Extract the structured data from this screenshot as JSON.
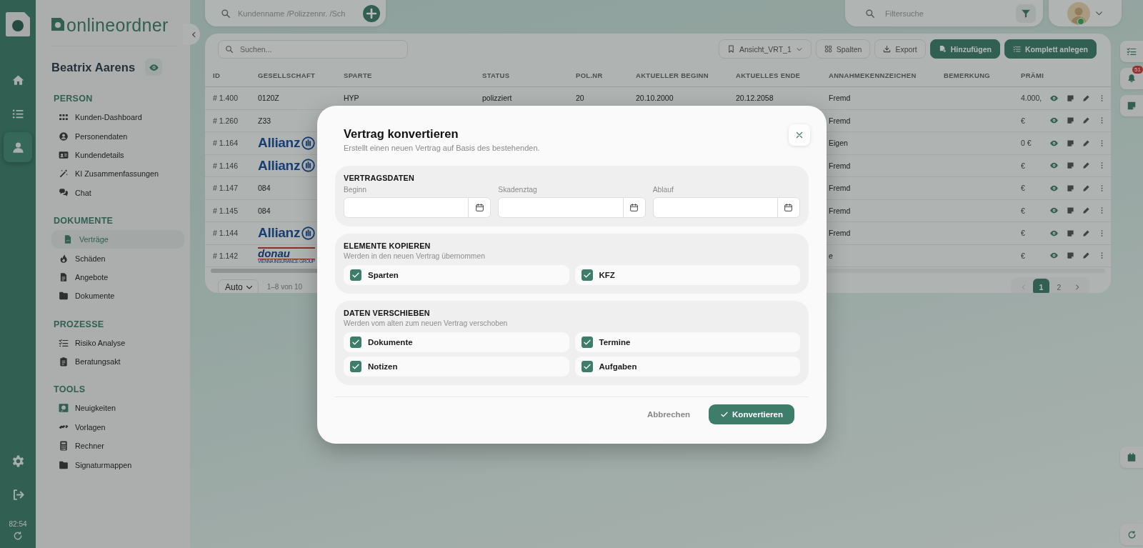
{
  "rail": {
    "items": [
      {
        "selected": false
      },
      {
        "selected": false
      },
      {
        "selected": true
      }
    ],
    "time": "82:54"
  },
  "sidebar": {
    "brand": "onlineordner",
    "customer_name": "Beatrix Aarens",
    "sections": [
      {
        "title": "PERSON",
        "items": [
          {
            "label": "Kunden-Dashboard",
            "selected": false
          },
          {
            "label": "Personendaten",
            "selected": false
          },
          {
            "label": "Kundendetails",
            "selected": false
          },
          {
            "label": "KI Zusammenfassungen",
            "selected": false
          },
          {
            "label": "Chat",
            "selected": false
          }
        ]
      },
      {
        "title": "DOKUMENTE",
        "items": [
          {
            "label": "Verträge",
            "selected": true
          },
          {
            "label": "Schäden",
            "selected": false
          },
          {
            "label": "Angebote",
            "selected": false
          },
          {
            "label": "Dokumente",
            "selected": false
          }
        ]
      },
      {
        "title": "PROZESSE",
        "items": [
          {
            "label": "Risiko Analyse",
            "selected": false
          },
          {
            "label": "Beratungsakt",
            "selected": false
          }
        ]
      },
      {
        "title": "TOOLS",
        "items": [
          {
            "label": "Neuigkeiten",
            "selected": false
          },
          {
            "label": "Vorlagen",
            "selected": false
          },
          {
            "label": "Rechner",
            "selected": false
          },
          {
            "label": "Signaturmappen",
            "selected": false
          }
        ]
      }
    ]
  },
  "top_bar": {
    "search": {
      "placeholder": "Kundenname /Polizzennr. /Sch"
    },
    "filter": {
      "placeholder": "Filtersuche"
    }
  },
  "table_toolbar": {
    "search": {
      "placeholder": "Suchen..."
    },
    "view": "Ansicht_VRT_1",
    "buttons": [
      {
        "label": "Spalten",
        "primary": false
      },
      {
        "label": "Export",
        "primary": false
      },
      {
        "label": "Hinzufügen",
        "primary": true
      },
      {
        "label": "Komplett anlegen",
        "primary": true
      }
    ]
  },
  "table": {
    "columns": [
      "ID",
      "GESELLSCHAFT",
      "SPARTE",
      "STATUS",
      "POL.NR",
      "AKTUELLER BEGINN",
      "AKTUELLES ENDE",
      "ANNAHMEKENNZEICHEN",
      "BEMERKUNG",
      "PRÄMI"
    ],
    "rows": [
      {
        "id": "# 1.400",
        "company": {
          "kind": "text",
          "text": "0120Z"
        },
        "sparte": "HYP",
        "status": "polizziert",
        "pol_nr": "20",
        "begin": "20.10.2000",
        "end": "20.12.2058",
        "annahme": "Fremd",
        "praemie": "4.000,"
      },
      {
        "id": "# 1.260",
        "company": {
          "kind": "text",
          "text": "Z33"
        },
        "annahme": "Fremd",
        "praemie": "€"
      },
      {
        "id": "# 1.164",
        "company": {
          "kind": "wordmark",
          "text": "Allianz"
        },
        "annahme": "Eigen",
        "praemie": "0 €"
      },
      {
        "id": "# 1.146",
        "company": {
          "kind": "wordmark",
          "text": "Allianz"
        },
        "annahme": "Fremd",
        "praemie": "€"
      },
      {
        "id": "# 1.147",
        "company": {
          "kind": "text",
          "text": "084"
        },
        "annahme": "Fremd",
        "praemie": "€"
      },
      {
        "id": "# 1.145",
        "company": {
          "kind": "text",
          "text": "084"
        },
        "annahme": "Fremd",
        "praemie": "€"
      },
      {
        "id": "# 1.144",
        "company": {
          "kind": "wordmark",
          "text": "Allianz"
        },
        "annahme": "Fremd",
        "praemie": "€"
      },
      {
        "id": "# 1.142",
        "company": {
          "kind": "striped",
          "text": "donau",
          "subtitle": "VIENNA INSURANCE GROUP"
        },
        "annahme": "e",
        "praemie": "€"
      }
    ]
  },
  "footer": {
    "page_size": "Auto",
    "range": "1–8 von 10",
    "prev_disabled": true,
    "pages": [
      {
        "label": "1",
        "selected": true
      },
      {
        "label": "2",
        "selected": false
      }
    ]
  },
  "right_strip": {
    "badge": "51"
  },
  "modal": {
    "title": "Vertrag konvertieren",
    "subtitle": "Erstellt einen neuen Vertrag auf Basis des bestehenden.",
    "sections": [
      {
        "kind": "dates",
        "title": "VERTRAGSDATEN",
        "fields": [
          {
            "label": "Beginn"
          },
          {
            "label": "Skadenztag"
          },
          {
            "label": "Ablauf"
          }
        ]
      },
      {
        "kind": "checks",
        "title": "ELEMENTE KOPIEREN",
        "hint": "Werden in den neuen Vertrag übernommen",
        "options": [
          {
            "label": "Sparten",
            "checked": true
          },
          {
            "label": "KFZ",
            "checked": true
          }
        ]
      },
      {
        "kind": "checks",
        "title": "DATEN VERSCHIEBEN",
        "hint": "Werden vom alten zum neuen Vertrag verschoben",
        "options": [
          {
            "label": "Dokumente",
            "checked": true
          },
          {
            "label": "Termine",
            "checked": true
          },
          {
            "label": "Notizen",
            "checked": true
          },
          {
            "label": "Aufgaben",
            "checked": true
          }
        ]
      }
    ],
    "cancel": "Abbrechen",
    "confirm": "Konvertieren"
  }
}
